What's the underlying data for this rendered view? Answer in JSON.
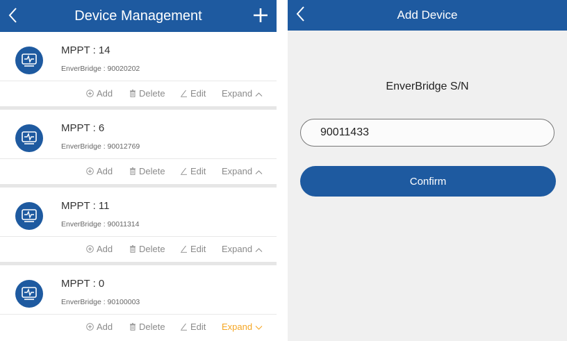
{
  "left": {
    "title": "Device Management",
    "devices": [
      {
        "name": "MPPT : 14",
        "sn": "EnverBridge : 90020202",
        "add": "Add",
        "delete": "Delete",
        "edit": "Edit",
        "expand": "Expand"
      },
      {
        "name": "MPPT : 6",
        "sn": "EnverBridge : 90012769",
        "add": "Add",
        "delete": "Delete",
        "edit": "Edit",
        "expand": "Expand"
      },
      {
        "name": "MPPT : 11",
        "sn": "EnverBridge : 90011314",
        "add": "Add",
        "delete": "Delete",
        "edit": "Edit",
        "expand": "Expand"
      },
      {
        "name": "MPPT : 0",
        "sn": "EnverBridge : 90100003",
        "add": "Add",
        "delete": "Delete",
        "edit": "Edit",
        "expand": "Expand"
      }
    ]
  },
  "right": {
    "title": "Add Device",
    "label": "EnverBridge S/N",
    "sn_value": "90011433",
    "confirm": "Confirm"
  },
  "colors": {
    "primary": "#1e5aa0",
    "expand_active": "#f5a623",
    "action_text": "#8a8a8a"
  },
  "icons": [
    "back-arrow-icon",
    "plus-icon",
    "monitor-icon",
    "add-circle-icon",
    "trash-icon",
    "pencil-icon",
    "chevron-up-icon",
    "chevron-down-icon"
  ]
}
